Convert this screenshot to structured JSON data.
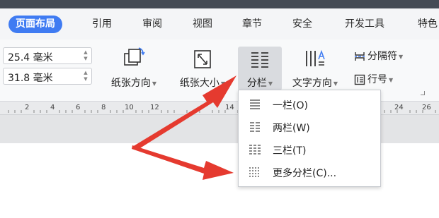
{
  "ribbon_tabs": [
    {
      "label": "页面布局",
      "active": true
    },
    {
      "label": "引用"
    },
    {
      "label": "审阅"
    },
    {
      "label": "视图"
    },
    {
      "label": "章节"
    },
    {
      "label": "安全"
    },
    {
      "label": "开发工具"
    },
    {
      "label": "特色"
    }
  ],
  "page_setup": {
    "spin_top_value": "25.4 毫米",
    "spin_bottom_value": "31.8 毫米",
    "orientation_label": "纸张方向",
    "size_label": "纸张大小",
    "columns_label": "分栏",
    "text_direction_label": "文字方向",
    "break_label": "分隔符",
    "line_number_label": "行号"
  },
  "ruler_labels": [
    "2",
    "4",
    "6",
    "8",
    "10",
    "12",
    "14",
    "24",
    "26"
  ],
  "columns_menu": [
    {
      "label": "一栏(O)",
      "icon": "one-column-icon"
    },
    {
      "label": "两栏(W)",
      "icon": "two-column-icon"
    },
    {
      "label": "三栏(T)",
      "icon": "three-column-icon"
    },
    {
      "label": "更多分栏(C)...",
      "icon": "more-columns-icon"
    }
  ],
  "colors": {
    "active_tab": "#3f7bf2",
    "annotation_arrow": "#e53a2f",
    "top_bar": "#454b55"
  }
}
